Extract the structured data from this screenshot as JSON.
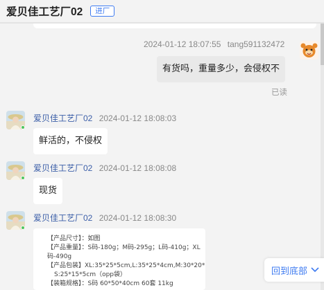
{
  "header": {
    "title": "爱贝佳工艺厂02",
    "badge": "进厂"
  },
  "messages": [
    {
      "timestamp": "2024-01-12 18:07:55",
      "sender": "tang591132472",
      "text": "有货吗，重量多少，会侵权不",
      "status": "已读"
    },
    {
      "sender": "爱贝佳工艺厂02",
      "timestamp": "2024-01-12 18:08:03",
      "text": "鲜活的，不侵权"
    },
    {
      "sender": "爱贝佳工艺厂02",
      "timestamp": "2024-01-12 18:08:08",
      "text": "现货"
    },
    {
      "sender": "爱贝佳工艺厂02",
      "timestamp": "2024-01-12 18:08:30",
      "card_lines": [
        "【产品尺寸】：如图",
        "【产品重量】：S码-180g；M码-295g；L码-410g；XL",
        "码-490g",
        "【产品包装】XL:35*25*5cm,L:35*25*4cm,M:30*20*5c",
        "S:25*15*5cm（opp袋）",
        "【装箱规格】：S码 60*50*40cm 60套 11kg"
      ]
    }
  ],
  "scroll_to_bottom": {
    "label": "回到底部"
  },
  "colors": {
    "accent": "#3e7bf1",
    "name": "#3b5ea8",
    "online": "#4ec55c"
  }
}
